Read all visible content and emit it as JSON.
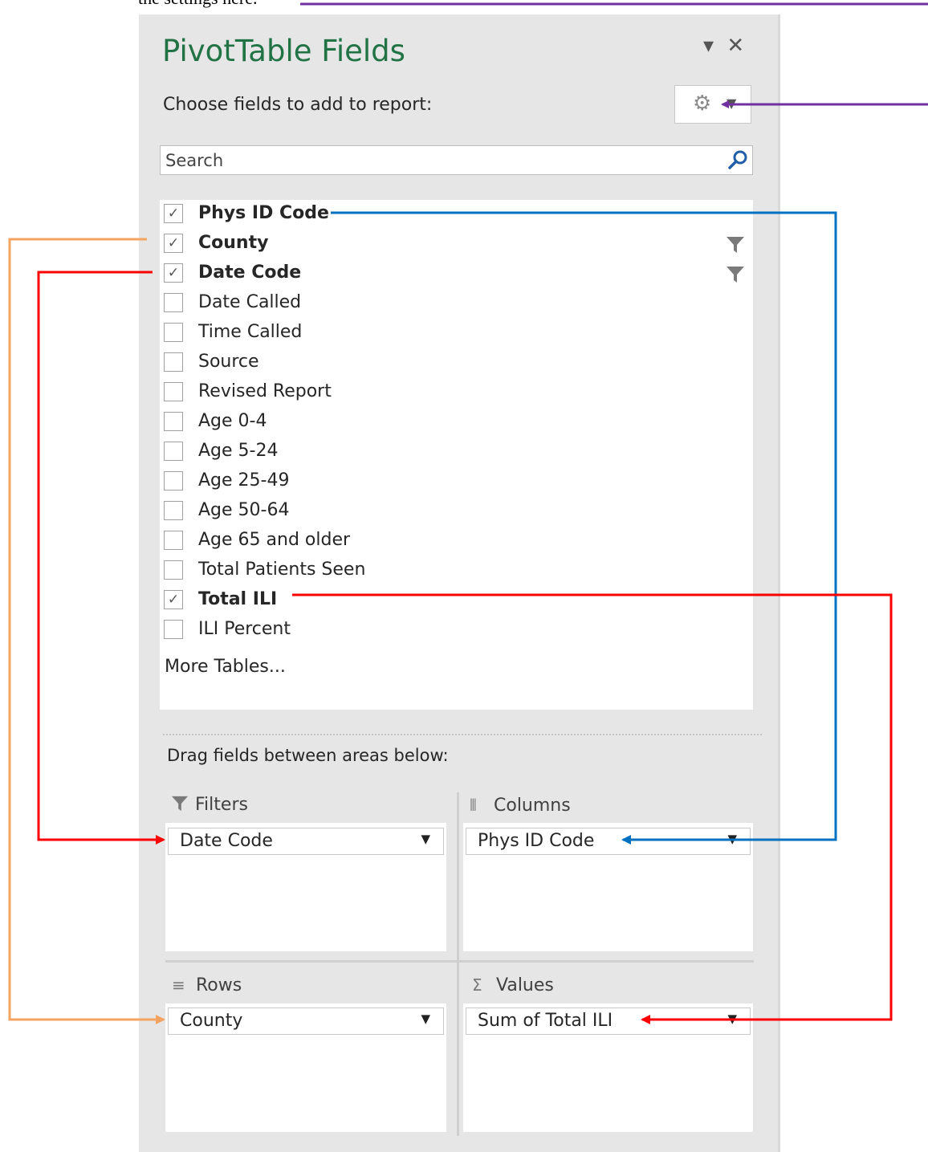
{
  "caption": "the settings here.",
  "pane": {
    "title": "PivotTable Fields",
    "dropdown_glyph": "▾",
    "close_glyph": "✕",
    "choose_label": "Choose fields to add to report:",
    "tools_icon": "gear-icon",
    "search_placeholder": "Search",
    "fields": [
      {
        "label": "Phys ID Code",
        "checked": true,
        "filtered": false
      },
      {
        "label": "County",
        "checked": true,
        "filtered": true
      },
      {
        "label": "Date Code",
        "checked": true,
        "filtered": true
      },
      {
        "label": "Date Called",
        "checked": false,
        "filtered": false
      },
      {
        "label": "Time Called",
        "checked": false,
        "filtered": false
      },
      {
        "label": "Source",
        "checked": false,
        "filtered": false
      },
      {
        "label": "Revised Report",
        "checked": false,
        "filtered": false
      },
      {
        "label": "Age 0-4",
        "checked": false,
        "filtered": false
      },
      {
        "label": "Age 5-24",
        "checked": false,
        "filtered": false
      },
      {
        "label": "Age 25-49",
        "checked": false,
        "filtered": false
      },
      {
        "label": "Age 50-64",
        "checked": false,
        "filtered": false
      },
      {
        "label": "Age 65 and older",
        "checked": false,
        "filtered": false
      },
      {
        "label": "Total Patients Seen",
        "checked": false,
        "filtered": false
      },
      {
        "label": "Total ILI",
        "checked": true,
        "filtered": false
      },
      {
        "label": "ILI Percent",
        "checked": false,
        "filtered": false
      }
    ],
    "more_tables": "More Tables...",
    "drag_label": "Drag fields between areas below:",
    "areas": {
      "filters": {
        "label": "Filters",
        "items": [
          "Date Code"
        ]
      },
      "columns": {
        "label": "Columns",
        "items": [
          "Phys ID Code"
        ]
      },
      "rows": {
        "label": "Rows",
        "items": [
          "County"
        ]
      },
      "values": {
        "label": "Values",
        "items": [
          "Sum of Total ILI"
        ]
      }
    }
  },
  "colors": {
    "title_green": "#217346",
    "arrow_purple": "#7030a0",
    "arrow_blue": "#0070c0",
    "arrow_red": "#ff0000",
    "arrow_orange": "#f4a460"
  }
}
